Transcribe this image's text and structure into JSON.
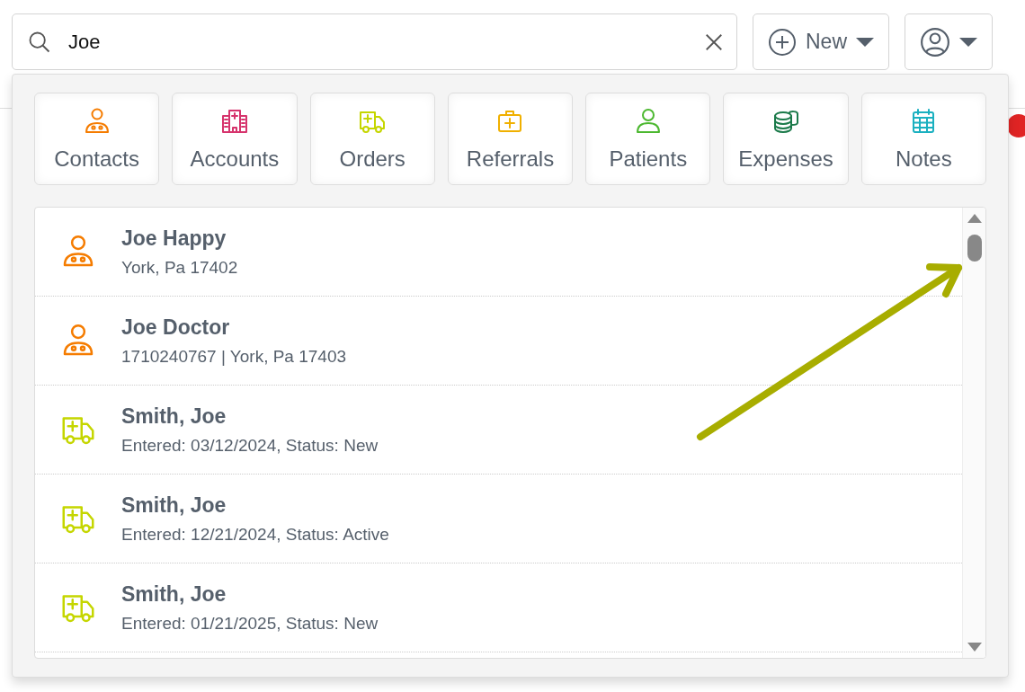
{
  "search": {
    "value": "Joe"
  },
  "new_button": {
    "label": "New"
  },
  "categories": [
    {
      "kind": "contact",
      "label": "Contacts",
      "color": "#f57c00"
    },
    {
      "kind": "account",
      "label": "Accounts",
      "color": "#d6336c"
    },
    {
      "kind": "order",
      "label": "Orders",
      "color": "#c5d600"
    },
    {
      "kind": "referral",
      "label": "Referrals",
      "color": "#f0b000"
    },
    {
      "kind": "patient",
      "label": "Patients",
      "color": "#4cb830"
    },
    {
      "kind": "expense",
      "label": "Expenses",
      "color": "#1b7a4a"
    },
    {
      "kind": "note",
      "label": "Notes",
      "color": "#1ab0c0"
    }
  ],
  "results": [
    {
      "kind": "contact",
      "title": "Joe Happy",
      "detail": "York, Pa 17402"
    },
    {
      "kind": "contact",
      "title": "Joe Doctor",
      "detail": "1710240767 | York, Pa 17403"
    },
    {
      "kind": "order",
      "title": "Smith, Joe",
      "detail": "Entered: 03/12/2024, Status: New"
    },
    {
      "kind": "order",
      "title": "Smith, Joe",
      "detail": "Entered: 12/21/2024, Status: Active"
    },
    {
      "kind": "order",
      "title": "Smith, Joe",
      "detail": "Entered: 01/21/2025, Status: New"
    }
  ]
}
